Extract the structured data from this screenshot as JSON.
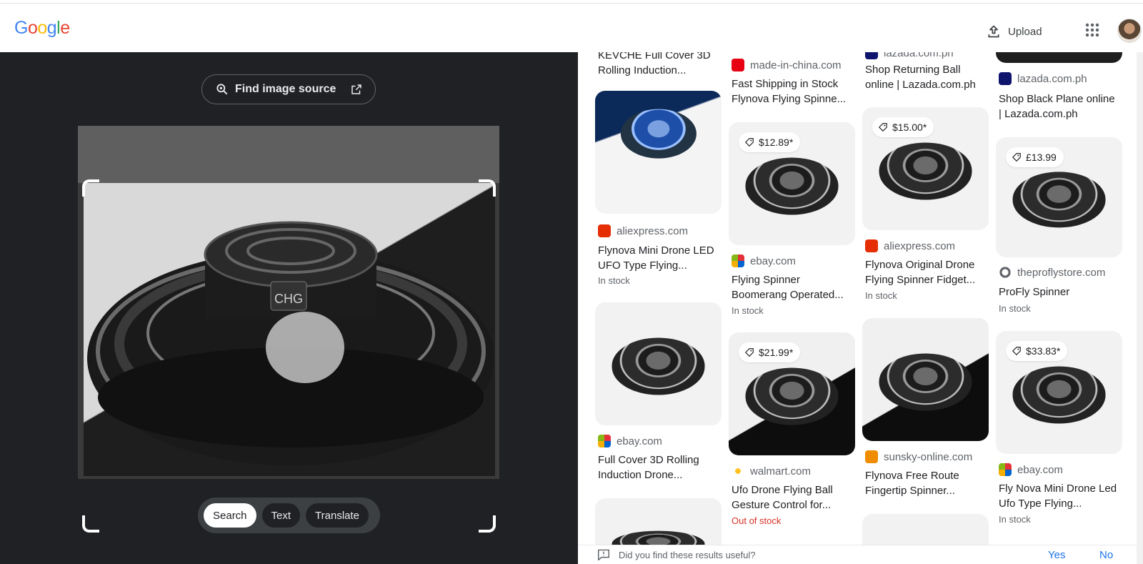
{
  "header": {
    "logo": [
      "G",
      "o",
      "o",
      "g",
      "l",
      "e"
    ],
    "logo_colors": [
      "#4285F4",
      "#EA4335",
      "#FBBC05",
      "#4285F4",
      "#34A853",
      "#EA4335"
    ],
    "upload_label": "Upload"
  },
  "lens": {
    "find_source_label": "Find image source",
    "modes": [
      {
        "label": "Search",
        "active": true
      },
      {
        "label": "Text",
        "active": false
      },
      {
        "label": "Translate",
        "active": false
      }
    ],
    "product_badge": "CHG"
  },
  "results": {
    "col1": [
      {
        "title": "KEVCHE Full Cover 3D Rolling Induction..."
      },
      {
        "source": "aliexpress.com",
        "favicon_color": "#e62e04",
        "title": "Flynova Mini Drone LED UFO Type Flying...",
        "stock": "In stock"
      },
      {
        "source": "ebay.com",
        "favicon_color": "#e53238",
        "title": "Full Cover 3D Rolling Induction Drone..."
      }
    ],
    "col2": [
      {
        "source": "made-in-china.com",
        "favicon_color": "#e60012",
        "title": "Fast Shipping in Stock Flynova Flying Spinne..."
      },
      {
        "price": "$12.89*",
        "source": "ebay.com",
        "favicon_color": "#e53238",
        "title": "Flying Spinner Boomerang Operated...",
        "stock": "In stock"
      },
      {
        "price": "$21.99*",
        "source": "walmart.com",
        "favicon_color": "#ffc220",
        "title": "Ufo Drone Flying Ball Gesture Control for...",
        "stock": "Out of stock"
      }
    ],
    "col3": [
      {
        "source": "lazada.com.ph",
        "favicon_color": "#0f146d",
        "title": "Shop Returning Ball online | Lazada.com.ph"
      },
      {
        "price": "$15.00*",
        "source": "aliexpress.com",
        "favicon_color": "#e62e04",
        "title": "Flynova Original Drone Flying Spinner Fidget...",
        "stock": "In stock"
      },
      {
        "source": "sunsky-online.com",
        "favicon_color": "#f08c00",
        "title": "Flynova Free Route Fingertip Spinner..."
      }
    ],
    "col4": [
      {
        "source": "lazada.com.ph",
        "favicon_color": "#0f146d",
        "title": "Shop Black Plane online | Lazada.com.ph"
      },
      {
        "price": "£13.99",
        "source": "theproflystore.com",
        "favicon_color": "#5f6368",
        "title": "ProFly Spinner",
        "stock": "In stock"
      },
      {
        "price": "$33.83*",
        "source": "ebay.com",
        "favicon_color": "#e53238",
        "title": "Fly Nova Mini Drone Led Ufo Type Flying...",
        "stock": "In stock"
      }
    ]
  },
  "feedback": {
    "question": "Did you find these results useful?",
    "yes": "Yes",
    "no": "No"
  }
}
